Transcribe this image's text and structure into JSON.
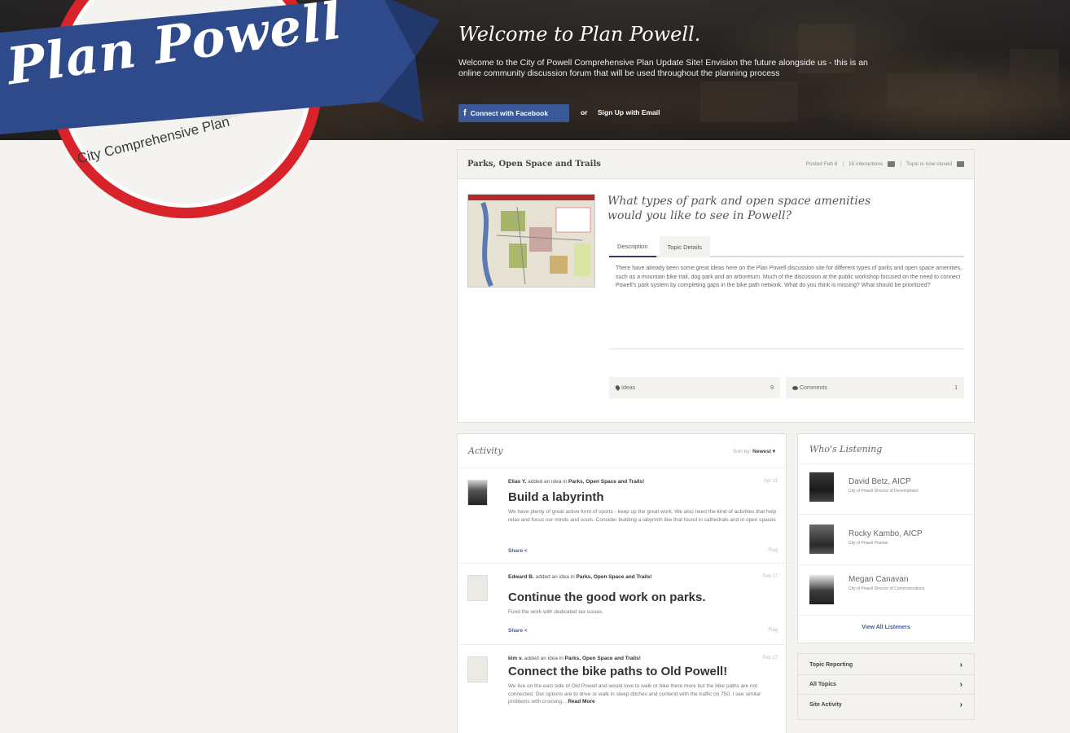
{
  "logo": {
    "title": "Plan Powell",
    "subtitle": "City Comprehensive Plan"
  },
  "hero": {
    "title": "Welcome to Plan Powell.",
    "subtitle": "Welcome to the City of Powell Comprehensive Plan Update Site! Envision the future alongside us - this is an online community discussion forum that will be used throughout the planning process",
    "facebook_button": "Connect with Facebook",
    "facebook_icon": "f",
    "or_text": "or",
    "signup_link": "Sign Up with Email"
  },
  "topic": {
    "header": "Parks, Open Space and Trails",
    "meta": {
      "posted": "Posted Feb 8",
      "interactions": "15 interactions",
      "views": "Topic is now closed"
    },
    "question": "What types of park and open space amenities would you like to see in Powell?",
    "tabs": [
      "Description",
      "Topic Details"
    ],
    "description": "There have already been some great ideas here on the Plan Powell discussion site for different types of parks and open space amenities, such as a mountain bike trail, dog park and an arboretum. Much of the discussion at the public workshop focused on the need to connect Powell's park system by completing gaps in the bike path network. What do you think is missing? What should be prioritized?",
    "ideas_label": "Ideas",
    "ideas_count": "9",
    "comments_label": "Comments",
    "comments_count": "1"
  },
  "activity": {
    "title": "Activity",
    "sort_label": "Sort by:",
    "sort_value": "Newest ▾",
    "items": [
      {
        "author": "Elias Y.",
        "action": "added an idea in",
        "topic": "Parks, Open Space and Trails!",
        "date": "Apr 11",
        "title": "Build a labyrinth",
        "body": "We have plenty of great active form of sports - keep up the great work. We also need the kind of activities that help relax and focus our minds and souls. Consider building a labyrinth like that found in cathedrals and in open spaces",
        "share": "Share",
        "flag": "Flag"
      },
      {
        "author": "Edward B.",
        "action": "added an idea in",
        "topic": "Parks, Open Space and Trails!",
        "date": "Feb 17",
        "title": "Continue the good work on parks.",
        "body": "Fund the work with dedicated tax issues.",
        "share": "Share",
        "flag": "Flag"
      },
      {
        "author": "kim v.",
        "action": "added an idea in",
        "topic": "Parks, Open Space and Trails!",
        "date": "Feb 17",
        "title": "Connect the bike paths to Old Powell!",
        "body": "We live on the east side of Old Powell and would love to walk or bike there more but the bike paths are not connected. Our options are to drive or walk in steep ditches and contend with the traffic on 750. I see similar problems with crossing...",
        "read_more": "Read More"
      }
    ]
  },
  "listening": {
    "title": "Who's Listening",
    "people": [
      {
        "name": "David Betz, AICP",
        "role": "City of Powell Director of Development"
      },
      {
        "name": "Rocky Kambo, AICP",
        "role": "City of Powell Planner"
      },
      {
        "name": "Megan Canavan",
        "role": "City of Powell Director of Communications"
      }
    ],
    "view_all": "View All Listeners"
  },
  "links": [
    "Topic Reporting",
    "All Topics",
    "Site Activity"
  ],
  "icons": {
    "share": "share-icon",
    "chevron": "chevron-right-icon",
    "pin": "pin-icon",
    "comment": "comment-icon"
  },
  "colors": {
    "brand_blue": "#2f4a8a",
    "brand_red": "#d8232a",
    "facebook": "#3b5998",
    "link": "#3b5fa0"
  }
}
